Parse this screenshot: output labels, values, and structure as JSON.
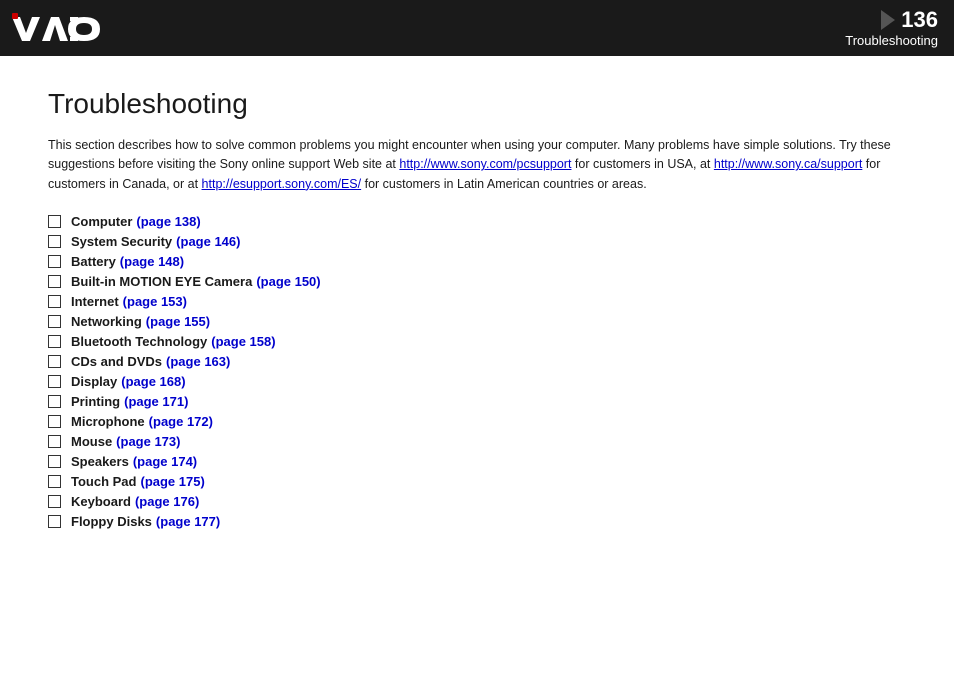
{
  "header": {
    "page_number": "136",
    "section_title": "Troubleshooting",
    "logo_alt": "VAIO"
  },
  "page": {
    "title": "Troubleshooting",
    "intro": "This section describes how to solve common problems you might encounter when using your computer. Many problems have simple solutions. Try these suggestions before visiting the Sony online support Web site at ",
    "link1_text": "http://www.sony.com/pcsupport",
    "link1_url": "http://www.sony.com/pcsupport",
    "intro_mid1": " for customers in USA, at ",
    "link2_text": "http://www.sony.ca/support",
    "link2_url": "http://www.sony.ca/support",
    "intro_mid2": " for customers in Canada, or at ",
    "link3_text": "http://esupport.sony.com/ES/",
    "link3_url": "http://esupport.sony.com/ES/",
    "intro_end": " for customers in Latin American countries or areas."
  },
  "toc": {
    "items": [
      {
        "label": "Computer",
        "link_text": "(page 138)",
        "link_page": 138
      },
      {
        "label": "System Security",
        "link_text": "(page 146)",
        "link_page": 146
      },
      {
        "label": "Battery",
        "link_text": "(page 148)",
        "link_page": 148
      },
      {
        "label": "Built-in MOTION EYE Camera",
        "link_text": "(page 150)",
        "link_page": 150
      },
      {
        "label": "Internet",
        "link_text": "(page 153)",
        "link_page": 153
      },
      {
        "label": "Networking",
        "link_text": "(page 155)",
        "link_page": 155
      },
      {
        "label": "Bluetooth Technology",
        "link_text": "(page 158)",
        "link_page": 158
      },
      {
        "label": "CDs and DVDs",
        "link_text": "(page 163)",
        "link_page": 163
      },
      {
        "label": "Display",
        "link_text": "(page 168)",
        "link_page": 168
      },
      {
        "label": "Printing",
        "link_text": "(page 171)",
        "link_page": 171
      },
      {
        "label": "Microphone",
        "link_text": "(page 172)",
        "link_page": 172
      },
      {
        "label": "Mouse",
        "link_text": "(page 173)",
        "link_page": 173
      },
      {
        "label": "Speakers",
        "link_text": "(page 174)",
        "link_page": 174
      },
      {
        "label": "Touch Pad",
        "link_text": "(page 175)",
        "link_page": 175
      },
      {
        "label": "Keyboard",
        "link_text": "(page 176)",
        "link_page": 176
      },
      {
        "label": "Floppy Disks",
        "link_text": "(page 177)",
        "link_page": 177
      }
    ]
  }
}
